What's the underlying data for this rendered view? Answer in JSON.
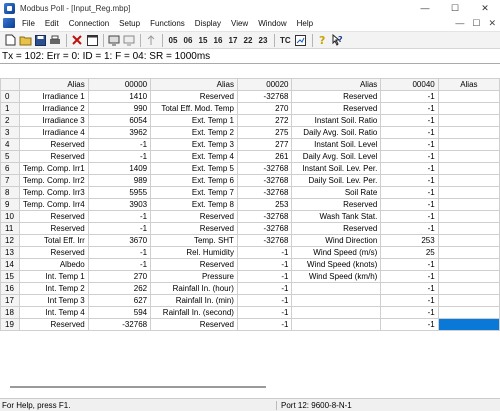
{
  "window": {
    "title": "Modbus Poll - [Input_Reg.mbp]",
    "buttons": [
      "—",
      "☐",
      "✕"
    ]
  },
  "menu": {
    "items": [
      "File",
      "Edit",
      "Connection",
      "Setup",
      "Functions",
      "Display",
      "View",
      "Window",
      "Help"
    ],
    "mdi": [
      "—",
      "☐",
      "✕"
    ]
  },
  "toolbar": {
    "func_codes": [
      "05",
      "06",
      "15",
      "16",
      "17",
      "22",
      "23"
    ],
    "tc_label": "TC"
  },
  "status_line": "Tx = 102: Err = 0: ID = 1: F = 04: SR = 1000ms",
  "grid": {
    "header": [
      "",
      "Alias",
      "00000",
      "Alias",
      "00020",
      "Alias",
      "00040",
      "Alias"
    ],
    "rows": [
      [
        "0",
        "Irradiance 1",
        "1410",
        "Reserved",
        "-32768",
        "Reserved",
        "-1"
      ],
      [
        "1",
        "Irradiance 2",
        "990",
        "Total Eff. Mod. Temp",
        "270",
        "Reserved",
        "-1"
      ],
      [
        "2",
        "Irradiance 3",
        "6054",
        "Ext. Temp 1",
        "272",
        "Instant Soil. Ratio",
        "-1"
      ],
      [
        "3",
        "Irradiance 4",
        "3962",
        "Ext. Temp 2",
        "275",
        "Daily Avg. Soil. Ratio",
        "-1"
      ],
      [
        "4",
        "Reserved",
        "-1",
        "Ext. Temp 3",
        "277",
        "Instant Soil. Level",
        "-1"
      ],
      [
        "5",
        "Reserved",
        "-1",
        "Ext. Temp 4",
        "261",
        "Daily Avg. Soil. Level",
        "-1"
      ],
      [
        "6",
        "Temp. Comp. Irr1",
        "1409",
        "Ext. Temp 5",
        "-32768",
        "Instant Soil. Lev. Per.",
        "-1"
      ],
      [
        "7",
        "Temp. Comp. Irr2",
        "989",
        "Ext. Temp 6",
        "-32768",
        "Daily Soil. Lev. Per.",
        "-1"
      ],
      [
        "8",
        "Temp. Comp. Irr3",
        "5955",
        "Ext. Temp 7",
        "-32768",
        "Soil Rate",
        "-1"
      ],
      [
        "9",
        "Temp. Comp. Irr4",
        "3903",
        "Ext. Temp 8",
        "253",
        "Reserved",
        "-1"
      ],
      [
        "10",
        "Reserved",
        "-1",
        "Reserved",
        "-32768",
        "Wash Tank Stat.",
        "-1"
      ],
      [
        "11",
        "Reserved",
        "-1",
        "Reserved",
        "-32768",
        "Reserved",
        "-1"
      ],
      [
        "12",
        "Total Eff. Irr",
        "3670",
        "Temp. SHT",
        "-32768",
        "Wind Direction",
        "253"
      ],
      [
        "13",
        "Reserved",
        "-1",
        "Rel. Humidity",
        "-1",
        "Wind Speed (m/s)",
        "25"
      ],
      [
        "14",
        "Albedo",
        "-1",
        "Reserved",
        "-1",
        "Wind Speed (knots)",
        "-1"
      ],
      [
        "15",
        "Int. Temp 1",
        "270",
        "Pressure",
        "-1",
        "Wind Speed (km/h)",
        "-1"
      ],
      [
        "16",
        "Int. Temp 2",
        "262",
        "Rainfall In. (hour)",
        "-1",
        "",
        "-1"
      ],
      [
        "17",
        "Int Temp 3",
        "627",
        "Rainfall In. (min)",
        "-1",
        "",
        "-1"
      ],
      [
        "18",
        "Int. Temp 4",
        "594",
        "Rainfall In. (second)",
        "-1",
        "",
        "-1"
      ],
      [
        "19",
        "Reserved",
        "-32768",
        "Reserved",
        "-1",
        "",
        "-1"
      ]
    ]
  },
  "statusbar": {
    "help": "For Help, press F1.",
    "port": "Port 12: 9600-8-N-1"
  },
  "colors": {
    "selection": "#0a78d7"
  }
}
